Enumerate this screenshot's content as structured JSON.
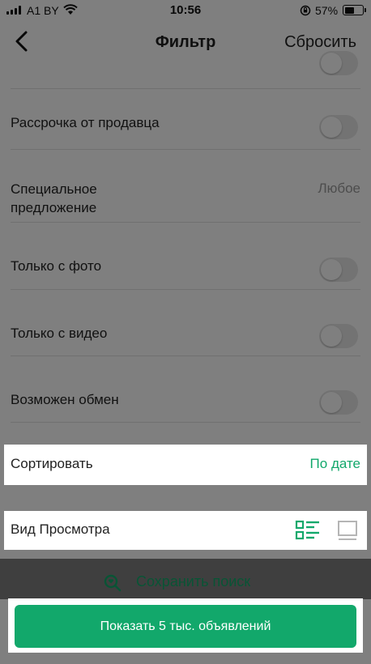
{
  "status_bar": {
    "carrier": "A1 BY",
    "time": "10:56",
    "battery": "57%",
    "battery_level": 0.57
  },
  "nav": {
    "title": "Фильтр",
    "reset": "Сбросить"
  },
  "filters": [
    {
      "label": "Рассрочка от продавца",
      "control": "toggle",
      "on": false
    },
    {
      "label": "Специальное предложение",
      "control": "value",
      "value": "Любое"
    },
    {
      "label": "Только с фото",
      "control": "toggle",
      "on": false
    },
    {
      "label": "Только с видео",
      "control": "toggle",
      "on": false
    },
    {
      "label": "Возможен обмен",
      "control": "toggle",
      "on": false
    }
  ],
  "sort": {
    "label": "Сортировать",
    "value": "По дате"
  },
  "view": {
    "label": "Вид Просмотра",
    "options": [
      "list-view-icon",
      "grid-view-icon"
    ],
    "selected": "list-view-icon"
  },
  "save_search": {
    "label": "Сохранить поиск"
  },
  "cta": {
    "label": "Показать 5 тыс. объявлений"
  },
  "colors": {
    "accent": "#12a86b",
    "toggle_off": "#e6e6e6",
    "overlay": "rgba(0,0,0,0.5)"
  }
}
